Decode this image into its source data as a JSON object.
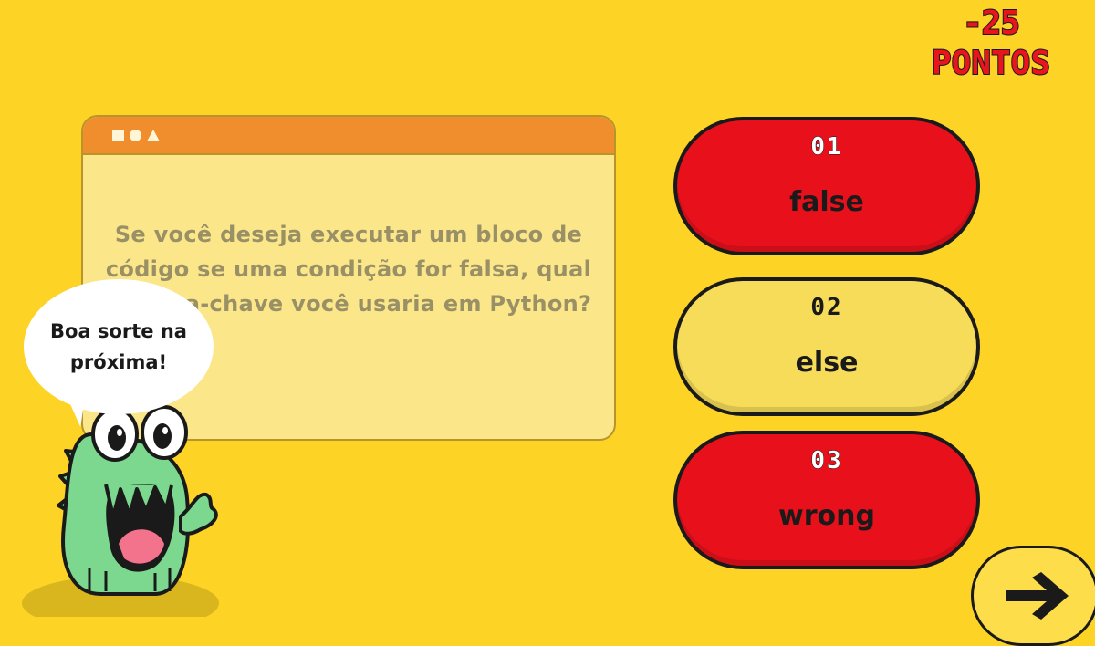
{
  "score": {
    "points": "-25",
    "label": "PONTOS"
  },
  "question": {
    "window_shapes": [
      "square-icon",
      "circle-icon",
      "triangle-icon"
    ],
    "text": "Se você deseja executar um bloco de código se uma condição for falsa, qual palavra-chave você usaria em Python?"
  },
  "answers": [
    {
      "number": "01",
      "text": "false",
      "state": "wrong"
    },
    {
      "number": "02",
      "text": "else",
      "state": "correct"
    },
    {
      "number": "03",
      "text": "wrong",
      "state": "wrong"
    }
  ],
  "feedback": {
    "message": "Boa sorte na próxima!"
  },
  "navigation": {
    "next_icon": "arrow-right-icon"
  },
  "colors": {
    "background": "#FDD326",
    "wrong": "#E8111B",
    "correct": "#F6DC58",
    "window_bar": "#F08E2E",
    "window_body": "#FBE68A"
  }
}
